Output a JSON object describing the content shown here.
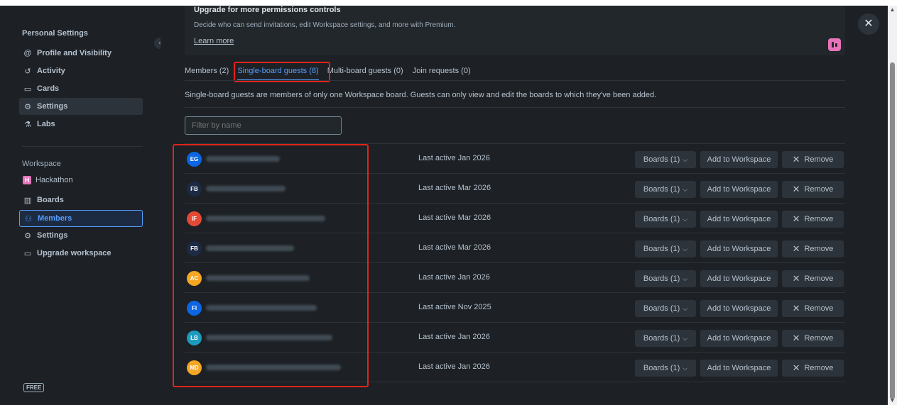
{
  "sidebar": {
    "personal_heading": "Personal Settings",
    "personal_items": [
      {
        "label": "Profile and Visibility",
        "icon": "at-icon"
      },
      {
        "label": "Activity",
        "icon": "history-icon"
      },
      {
        "label": "Cards",
        "icon": "card-icon"
      },
      {
        "label": "Settings",
        "icon": "gear-icon"
      },
      {
        "label": "Labs",
        "icon": "flask-icon"
      }
    ],
    "workspace_heading": "Workspace",
    "workspace_name": "Hackathon",
    "workspace_badge": "H",
    "workspace_items": [
      {
        "label": "Boards",
        "icon": "boards-icon"
      },
      {
        "label": "Members",
        "icon": "members-icon"
      },
      {
        "label": "Settings",
        "icon": "gear-icon"
      },
      {
        "label": "Upgrade workspace",
        "icon": "card-icon"
      }
    ],
    "plan_badge": "FREE"
  },
  "banner": {
    "title": "Upgrade for more permissions controls",
    "description": "Decide who can send invitations, edit Workspace settings, and more with Premium.",
    "link": "Learn more"
  },
  "tabs": [
    {
      "label": "Members (2)",
      "active": false
    },
    {
      "label": "Single-board guests (8)",
      "active": true
    },
    {
      "label": "Multi-board guests (0)",
      "active": false
    },
    {
      "label": "Join requests (0)",
      "active": false
    }
  ],
  "description": "Single-board guests are members of only one Workspace board. Guests can only view and edit the boards to which they've been added.",
  "filter": {
    "placeholder": "Filter by name"
  },
  "buttons": {
    "boards": "Boards (1)",
    "add": "Add to Workspace",
    "remove": "Remove"
  },
  "guests": [
    {
      "initials": "EG",
      "color": "#0c66e4",
      "last_active": "Last active Jan 2026"
    },
    {
      "initials": "FB",
      "color": "#1d2a45",
      "last_active": "Last active Mar 2026"
    },
    {
      "initials": "IF",
      "color": "#e34935",
      "last_active": "Last active Mar 2026"
    },
    {
      "initials": "FB",
      "color": "#1d2a45",
      "last_active": "Last active Mar 2026"
    },
    {
      "initials": "AC",
      "color": "#f5a623",
      "last_active": "Last active Jan 2026"
    },
    {
      "initials": "FI",
      "color": "#0c66e4",
      "last_active": "Last active Nov 2025"
    },
    {
      "initials": "LB",
      "color": "#1d9bbd",
      "last_active": "Last active Jan 2026"
    },
    {
      "initials": "MD",
      "color": "#f5a623",
      "last_active": "Last active Jan 2026"
    }
  ]
}
